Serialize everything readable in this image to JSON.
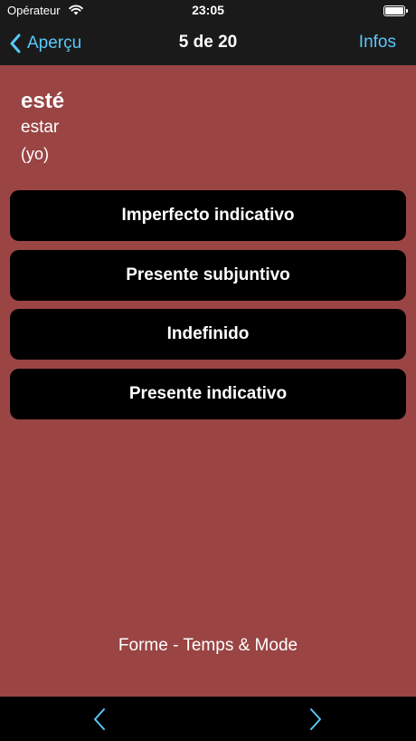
{
  "status": {
    "carrier": "Opérateur",
    "time": "23:05"
  },
  "nav": {
    "back_label": "Aperçu",
    "title": "5 de 20",
    "info_label": "Infos"
  },
  "question": {
    "form": "esté",
    "infinitive": "estar",
    "pronoun": "(yo)"
  },
  "options": [
    {
      "label": "Imperfecto indicativo"
    },
    {
      "label": "Presente subjuntivo"
    },
    {
      "label": "Indefinido"
    },
    {
      "label": "Presente indicativo"
    }
  ],
  "footer": {
    "label": "Forme - Temps & Mode"
  },
  "colors": {
    "background": "#9a4444",
    "accent": "#5ac8fa",
    "bar": "#1a1a1a",
    "button": "#000000"
  },
  "icons": {
    "back": "chevron-left-icon",
    "prev": "chevron-left-icon",
    "next": "chevron-right-icon",
    "wifi": "wifi-icon",
    "battery": "battery-icon"
  }
}
